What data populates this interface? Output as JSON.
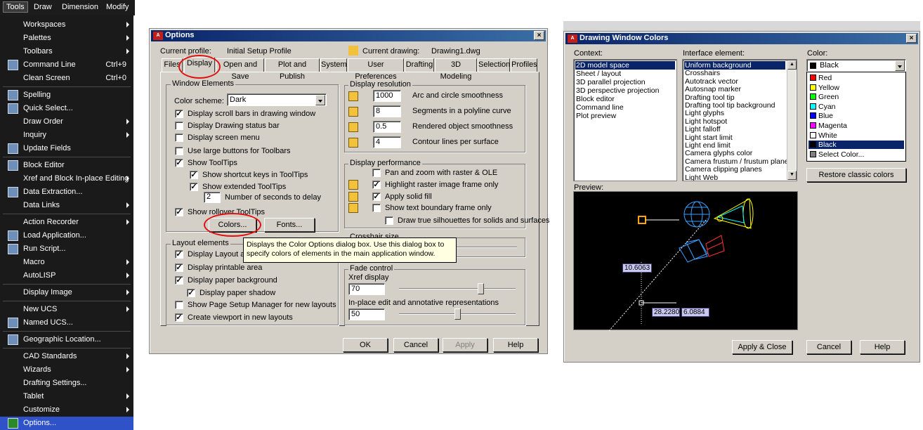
{
  "tools_menu": {
    "menubar": [
      "Tools",
      "Draw",
      "Dimension",
      "Modify"
    ],
    "items": [
      {
        "label": "Workspaces",
        "arrow": true
      },
      {
        "label": "Palettes",
        "arrow": true
      },
      {
        "label": "Toolbars",
        "arrow": true
      },
      {
        "label": "Command Line",
        "shortcut": "Ctrl+9",
        "icon": "command-line-icon"
      },
      {
        "label": "Clean Screen",
        "shortcut": "Ctrl+0"
      },
      {
        "label": "Spelling",
        "icon": "spelling-icon"
      },
      {
        "label": "Quick Select...",
        "icon": "quick-select-icon"
      },
      {
        "label": "Draw Order",
        "arrow": true
      },
      {
        "label": "Inquiry",
        "arrow": true
      },
      {
        "label": "Update Fields",
        "icon": "update-fields-icon"
      },
      {
        "label": "Block Editor",
        "icon": "block-editor-icon"
      },
      {
        "label": "Xref and Block In-place Editing",
        "arrow": true
      },
      {
        "label": "Data Extraction...",
        "icon": "data-extraction-icon"
      },
      {
        "label": "Data Links",
        "arrow": true
      },
      {
        "label": "Action Recorder",
        "arrow": true
      },
      {
        "label": "Load Application...",
        "icon": "load-application-icon"
      },
      {
        "label": "Run Script...",
        "icon": "run-script-icon"
      },
      {
        "label": "Macro",
        "arrow": true
      },
      {
        "label": "AutoLISP",
        "arrow": true
      },
      {
        "label": "Display Image",
        "arrow": true
      },
      {
        "label": "New UCS",
        "arrow": true
      },
      {
        "label": "Named UCS...",
        "icon": "named-ucs-icon"
      },
      {
        "label": "Geographic Location...",
        "icon": "globe-icon"
      },
      {
        "label": "CAD Standards",
        "arrow": true
      },
      {
        "label": "Wizards",
        "arrow": true
      },
      {
        "label": "Drafting Settings..."
      },
      {
        "label": "Tablet",
        "arrow": true
      },
      {
        "label": "Customize",
        "arrow": true
      },
      {
        "label": "Options...",
        "icon": "options-check-icon",
        "selected": true
      }
    ]
  },
  "options": {
    "title": "Options",
    "close": "×",
    "current_profile_label": "Current profile:",
    "current_profile": "Initial Setup Profile",
    "current_drawing_label": "Current drawing:",
    "current_drawing": "Drawing1.dwg",
    "tabs": [
      "Files",
      "Display",
      "Open and Save",
      "Plot and Publish",
      "System",
      "User Preferences",
      "Drafting",
      "3D Modeling",
      "Selection",
      "Profiles"
    ],
    "active_tab": "Display",
    "window_elements": {
      "title": "Window Elements",
      "color_scheme_label": "Color scheme:",
      "color_scheme": "Dark",
      "options": [
        {
          "label": "Display scroll bars in drawing window",
          "checked": true
        },
        {
          "label": "Display Drawing status bar",
          "checked": false
        },
        {
          "label": "Display screen menu",
          "checked": false
        },
        {
          "label": "Use large buttons for Toolbars",
          "checked": false
        },
        {
          "label": "Show ToolTips",
          "checked": true
        },
        {
          "label": "Show shortcut keys in ToolTips",
          "checked": true
        },
        {
          "label": "Show extended ToolTips",
          "checked": true
        },
        {
          "label": "Show rollover ToolTips",
          "checked": true
        }
      ],
      "delay_value": "2",
      "delay_label": "Number of seconds to delay",
      "colors_button": "Colors...",
      "fonts_button": "Fonts..."
    },
    "layout_elements": {
      "title": "Layout elements",
      "options": [
        {
          "label": "Display Layout and",
          "checked": true
        },
        {
          "label": "Display printable area",
          "checked": true
        },
        {
          "label": "Display paper background",
          "checked": true
        },
        {
          "label": "Display paper shadow",
          "checked": true
        },
        {
          "label": "Show Page Setup Manager for new layouts",
          "checked": false
        },
        {
          "label": "Create viewport in new layouts",
          "checked": true
        }
      ]
    },
    "display_resolution": {
      "title": "Display resolution",
      "rows": [
        {
          "value": "1000",
          "label": "Arc and circle smoothness"
        },
        {
          "value": "8",
          "label": "Segments in a polyline curve"
        },
        {
          "value": "0.5",
          "label": "Rendered object smoothness"
        },
        {
          "value": "4",
          "label": "Contour lines per surface"
        }
      ]
    },
    "display_performance": {
      "title": "Display performance",
      "options": [
        {
          "label": "Pan and zoom with raster & OLE",
          "checked": false
        },
        {
          "label": "Highlight raster image frame only",
          "checked": true
        },
        {
          "label": "Apply solid fill",
          "checked": true
        },
        {
          "label": "Show text boundary frame only",
          "checked": false
        },
        {
          "label": "Draw true silhouettes for solids and surfaces",
          "checked": false
        }
      ]
    },
    "crosshair_title": "Crosshair size",
    "fade_control": {
      "title": "Fade control",
      "xref_label": "Xref display",
      "xref_value": "70",
      "inplace_label": "In-place edit and annotative representations",
      "inplace_value": "50",
      "xref_level": 0.7,
      "inplace_level": 0.5
    },
    "tooltip": "Displays the Color Options dialog box. Use this dialog box to specify colors of elements in the main application window.",
    "buttons": {
      "ok": "OK",
      "cancel": "Cancel",
      "apply": "Apply",
      "help": "Help"
    }
  },
  "dwc": {
    "title": "Drawing Window Colors",
    "close": "×",
    "context_label": "Context:",
    "context_items": [
      "2D model space",
      "Sheet / layout",
      "3D parallel projection",
      "3D perspective projection",
      "Block editor",
      "Command line",
      "Plot preview"
    ],
    "interface_label": "Interface element:",
    "interface_items": [
      "Uniform background",
      "Crosshairs",
      "Autotrack vector",
      "Autosnap marker",
      "Drafting tool tip",
      "Drafting tool tip background",
      "Light glyphs",
      "Light hotspot",
      "Light falloff",
      "Light start limit",
      "Light end limit",
      "Camera glyphs color",
      "Camera frustum / frustum plane",
      "Camera clipping planes",
      "Light Web"
    ],
    "color_label": "Color:",
    "color_selected": "Black",
    "colors": [
      {
        "name": "Red",
        "hex": "#ff0000"
      },
      {
        "name": "Yellow",
        "hex": "#ffff00"
      },
      {
        "name": "Green",
        "hex": "#00ff00"
      },
      {
        "name": "Cyan",
        "hex": "#00ffff"
      },
      {
        "name": "Blue",
        "hex": "#0000ff"
      },
      {
        "name": "Magenta",
        "hex": "#ff00ff"
      },
      {
        "name": "White",
        "hex": "#ffffff"
      },
      {
        "name": "Black",
        "hex": "#000000"
      },
      {
        "name": "Select Color...",
        "hex": "#808080"
      }
    ],
    "restore_button": "Restore classic colors",
    "preview_label": "Preview:",
    "preview_values": [
      "10.6063",
      "28.2280",
      "6.0884"
    ],
    "buttons": {
      "apply": "Apply & Close",
      "cancel": "Cancel",
      "help": "Help"
    }
  }
}
